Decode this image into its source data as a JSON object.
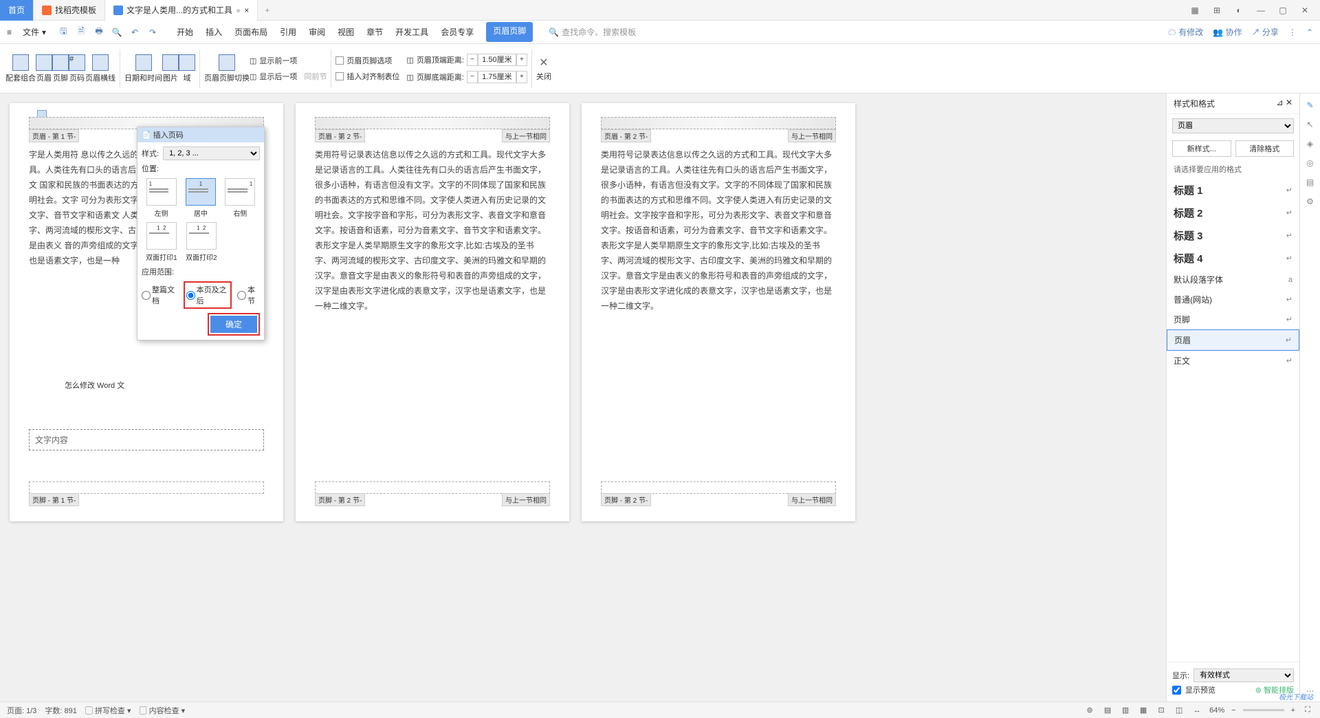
{
  "tabs": {
    "home": "首页",
    "t1": "找稻壳模板",
    "t2": "文字是人类用...的方式和工具",
    "add": "+"
  },
  "win": {
    "grid": "▦",
    "apps": "⊞",
    "user": "◐",
    "min": "—",
    "max": "▢",
    "close": "✕"
  },
  "menu": {
    "file": "文件",
    "start": "开始",
    "insert": "插入",
    "pagelayout": "页面布局",
    "ref": "引用",
    "review": "审阅",
    "view": "视图",
    "chapter": "章节",
    "dev": "开发工具",
    "vip": "会员专享",
    "hf": "页眉页脚",
    "search": "查找命令、搜索模板"
  },
  "rightmenu": {
    "changes": "有修改",
    "coop": "协作",
    "share": "分享"
  },
  "ribbon": {
    "set": "配套组合",
    "header": "页眉",
    "footer": "页脚",
    "pagenum": "页码",
    "hline": "页眉横线",
    "datetime": "日期和时间",
    "image": "图片",
    "field": "域",
    "hfswitch": "页眉页脚切换",
    "showprev": "显示前一项",
    "shownext": "显示后一项",
    "sameprev": "同前节",
    "hfopt": "页眉页脚选项",
    "inserttab": "插入对齐制表位",
    "hdist": "页眉顶端距离:",
    "fdist": "页脚底端距离:",
    "hval": "1.50厘米",
    "fval": "1.75厘米",
    "close": "关闭"
  },
  "popup": {
    "title": "插入页码",
    "format": "样式:",
    "format_val": "1, 2, 3 ...",
    "pos": "位置:",
    "opts": [
      "左侧",
      "居中",
      "右侧",
      "双面打印1",
      "双面打印2"
    ],
    "range": "应用范围:",
    "r1": "整篇文档",
    "r2": "本页及之后",
    "r3": "本节",
    "ok": "确定"
  },
  "pages": {
    "p1": {
      "tag": "页眉 - 第 1 节-",
      "body": "字是人类用符                    息以传之久远的方式和工具。现代文字                                         录的工具。人类往先有口头的语言后                                  很多小语种，有语言但没有文字。文                                  国家和民族的书面表达的方式和思维                                  类进入有历史记录的文明社会。文字                                  可分为表形文字、表音文字和意音文                                  可分为音素文字、音节文字和语素文                                  人类早期原生文字的象形文字,                                        的圣书字、两河流域的楔形文字、古印度文                                  文和早期的汉字。意音文字是由表义                                  音的声旁组成的文字，汉字是由表形                                  表意文字，汉字也是语素文字，也是一种",
      "note": "怎么修改 Word 文",
      "box": "文字内容",
      "ftag": "页脚 - 第 1 节-"
    },
    "p2": {
      "tag": "页眉 - 第 2 节-",
      "tagr": "与上一节相同",
      "body": "类用符号记录表达信息以传之久远的方式和工具。现代文字大多是记录语言的工具。人类往往先有口头的语言后产生书面文字，很多小语种，有语言但没有文字。文字的不同体现了国家和民族的书面表达的方式和思维不同。文字使人类进入有历史记录的文明社会。文字按字音和字形，可分为表形文字、表音文字和意音文字。按语音和语素，可分为音素文字、音节文字和语素文字。表形文字是人类早期原生文字的象形文字,比如:古埃及的圣书字、两河流域的楔形文字、古印度文字、美洲的玛雅文和早期的汉字。意音文字是由表义的象形符号和表音的声旁组成的文字，汉字是由表形文字进化成的表意文字，汉字也是语素文字，也是一种二维文字。",
      "ftag": "页脚 - 第 2 节-",
      "ftagr": "与上一节相同"
    },
    "p3": {
      "tag": "页眉 - 第 2 节-",
      "tagr": "与上一节相同",
      "body": "类用符号记录表达信息以传之久远的方式和工具。现代文字大多是记录语言的工具。人类往往先有口头的语言后产生书面文字，很多小语种，有语言但没有文字。文字的不同体现了国家和民族的书面表达的方式和思维不同。文字使人类进入有历史记录的文明社会。文字按字音和字形，可分为表形文字、表音文字和意音文字。按语音和语素，可分为音素文字、音节文字和语素文字。表形文字是人类早期原生文字的象形文字,比如:古埃及的圣书字、两河流域的楔形文字、古印度文字、美洲的玛雅文和早期的汉字。意音文字是由表义的象形符号和表音的声旁组成的文字，汉字是由表形文字进化成的表意文字，汉字也是语素文字，也是一种二维文字。",
      "ftag": "页脚 - 第 2 节-",
      "ftagr": "与上一节相同"
    }
  },
  "panel": {
    "title": "样式和格式",
    "sel": "页眉",
    "new": "新样式...",
    "clear": "清除格式",
    "prompt": "请选择要应用的格式",
    "styles": [
      "标题 1",
      "标题 2",
      "标题 3",
      "标题 4",
      "默认段落字体",
      "普通(网站)",
      "页脚",
      "页眉",
      "正文"
    ],
    "sel_idx": 7,
    "show": "显示:",
    "showval": "有效样式",
    "preview": "显示预览",
    "smart": "智能排版"
  },
  "status": {
    "page": "页面: 1/3",
    "words": "字数: 891",
    "spell": "拼写检查",
    "content": "内容检查",
    "zoom": "64%"
  },
  "watermark": "极光下载站"
}
